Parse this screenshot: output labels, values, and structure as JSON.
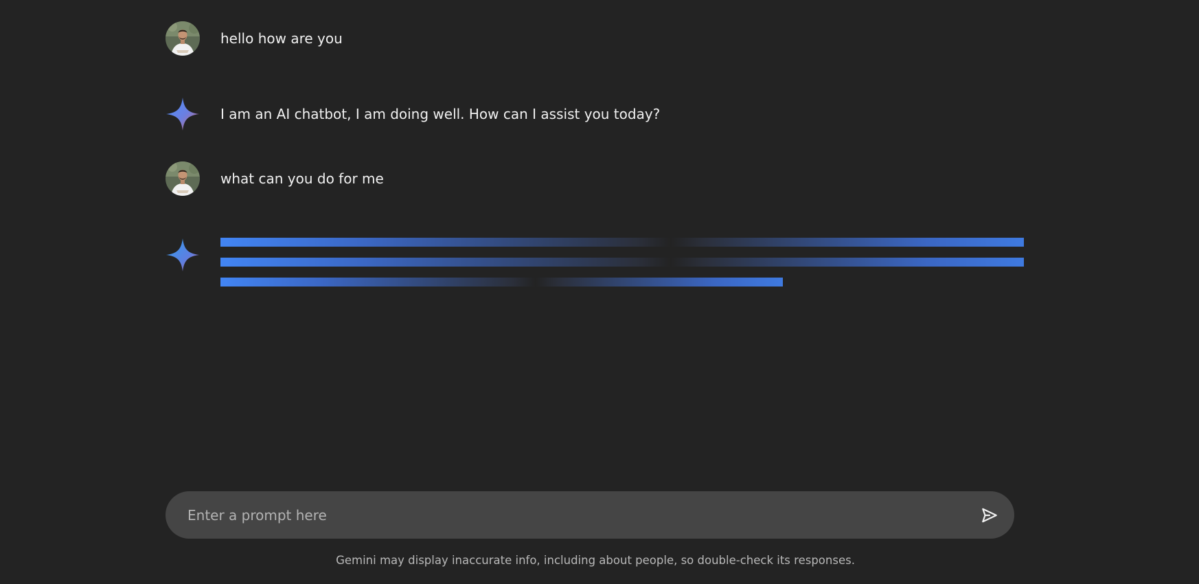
{
  "conversation": [
    {
      "role": "user",
      "text": "hello how are you",
      "icon": "user-avatar"
    },
    {
      "role": "assistant",
      "text": "I am an AI chatbot, I am doing well. How can I assist you today?",
      "icon": "gemini-sparkle-icon"
    },
    {
      "role": "user",
      "text": "what can you do for me",
      "icon": "user-avatar"
    },
    {
      "role": "assistant",
      "loading": true,
      "icon": "gemini-sparkle-icon"
    }
  ],
  "prompt": {
    "placeholder": "Enter a prompt here",
    "value": "",
    "send_icon": "send-icon"
  },
  "footer": {
    "disclaimer": "Gemini may display inaccurate info, including about people, so double-check its responses."
  },
  "colors": {
    "background": "#232323",
    "input_background": "#454545",
    "loader_accent": "#4285f4",
    "gem_start": "#4b90ff",
    "gem_end": "#9168c0"
  }
}
